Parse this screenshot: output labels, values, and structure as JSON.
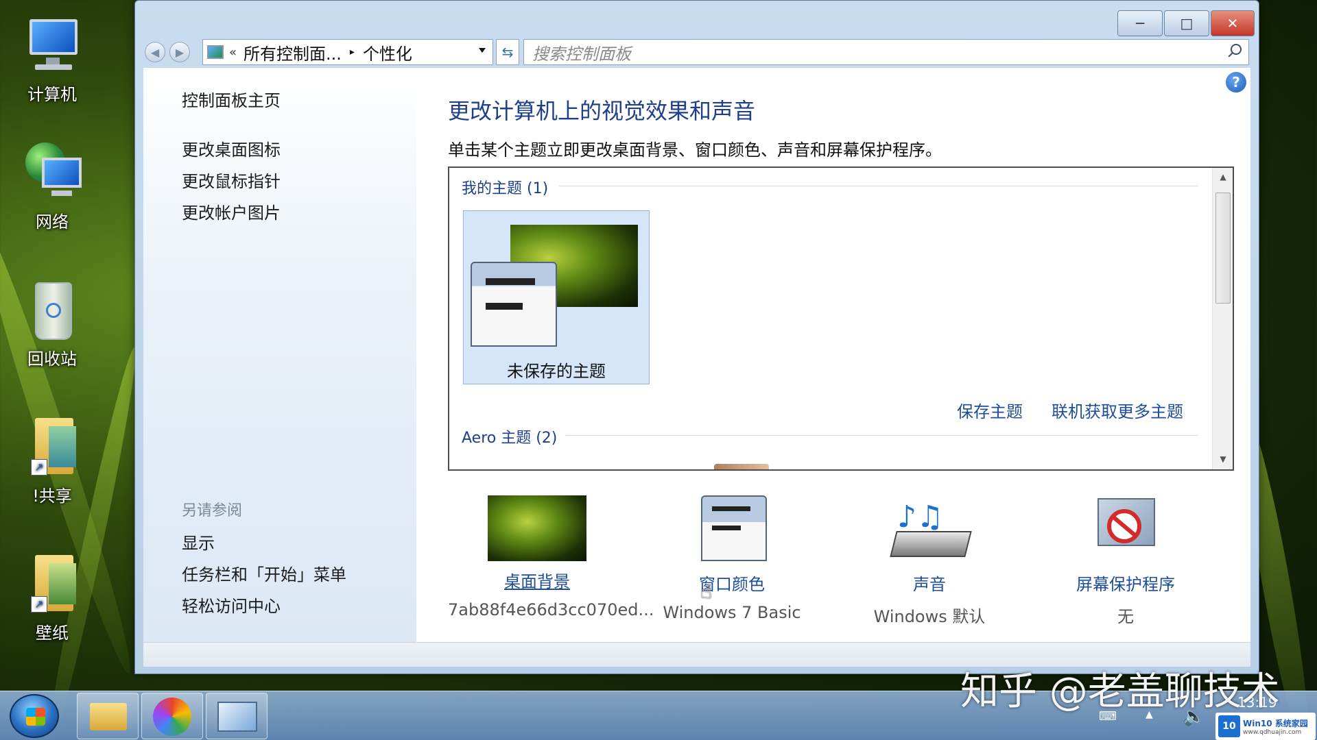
{
  "desktop": {
    "icons": [
      {
        "label": "计算机",
        "icon": "computer-icon"
      },
      {
        "label": "网络",
        "icon": "network-icon"
      },
      {
        "label": "回收站",
        "icon": "recycle-bin-icon"
      },
      {
        "label": "!共享",
        "icon": "folder-shortcut-icon"
      },
      {
        "label": "壁纸",
        "icon": "folder-shortcut-icon"
      }
    ]
  },
  "window": {
    "breadcrumb": {
      "prefix": "«",
      "part1": "所有控制面...",
      "separator": "▸",
      "part2": "个性化"
    },
    "search_placeholder": "搜索控制面板",
    "caption": {
      "minimize": "─",
      "maximize": "□",
      "close": "✕"
    }
  },
  "sidebar": {
    "home": "控制面板主页",
    "links": [
      "更改桌面图标",
      "更改鼠标指针",
      "更改帐户图片"
    ],
    "see_also_title": "另请参阅",
    "see_also": [
      "显示",
      "任务栏和「开始」菜单",
      "轻松访问中心"
    ]
  },
  "main": {
    "title": "更改计算机上的视觉效果和声音",
    "description": "单击某个主题立即更改桌面背景、窗口颜色、声音和屏幕保护程序。",
    "my_themes_header": "我的主题 (1)",
    "unsaved_theme_label": "未保存的主题",
    "save_theme": "保存主题",
    "get_more_themes": "联机获取更多主题",
    "aero_header": "Aero 主题 (2)",
    "help": "?"
  },
  "settings": [
    {
      "name": "桌面背景",
      "value": "7ab88f4e66d3cc070ed..."
    },
    {
      "name": "窗口颜色",
      "value": "Windows 7 Basic"
    },
    {
      "name": "声音",
      "value": "Windows 默认"
    },
    {
      "name": "屏幕保护程序",
      "value": "无"
    }
  ],
  "taskbar": {
    "clock": "13:19",
    "watermark": "知乎 @老盖聊技术",
    "badge": "Win10 系统家园",
    "badge_url": "www.qdhuajin.com"
  },
  "colors": {
    "accent": "#1e3f8c",
    "link": "#1e4d9a",
    "close": "#c2362a"
  }
}
